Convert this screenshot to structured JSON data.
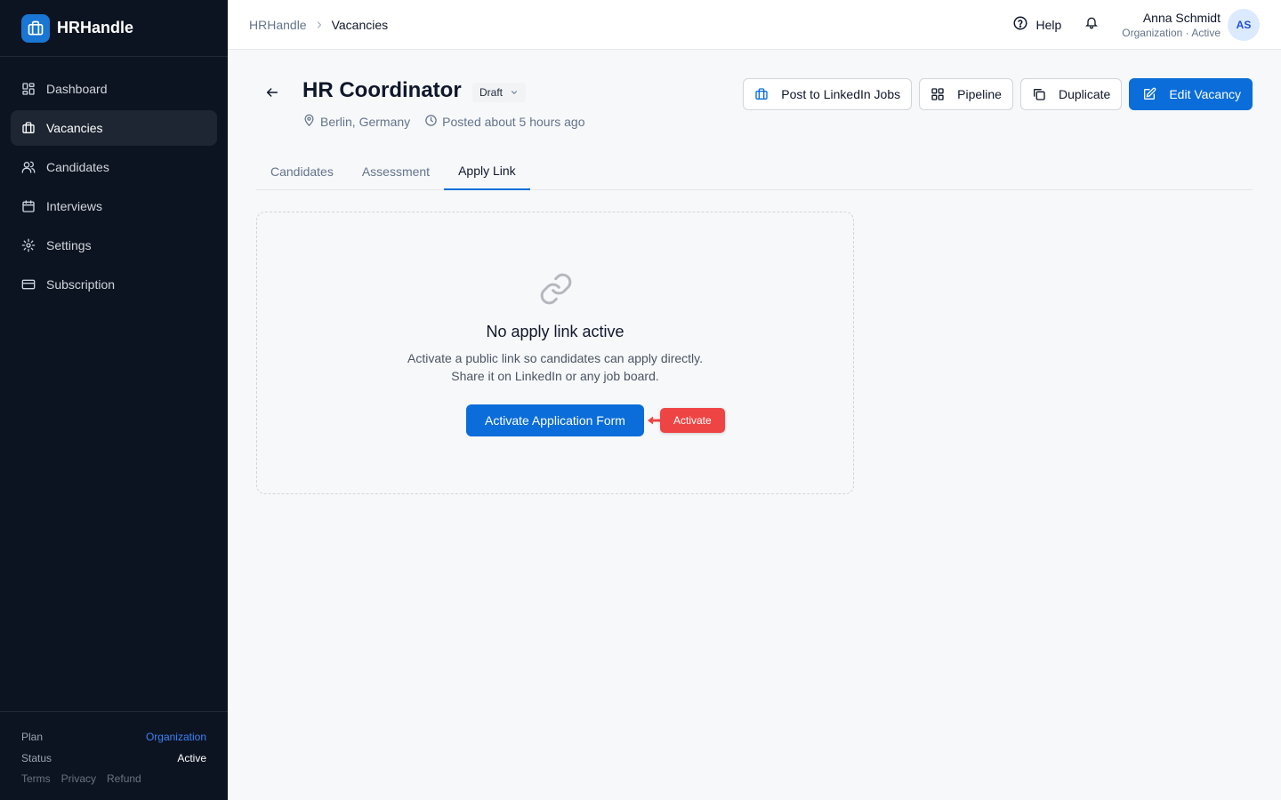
{
  "brand": {
    "name": "HRHandle",
    "icon": "briefcase-icon"
  },
  "sidebar": {
    "items": [
      {
        "label": "Dashboard",
        "icon": "dashboard-icon"
      },
      {
        "label": "Vacancies",
        "icon": "briefcase-icon",
        "active": true
      },
      {
        "label": "Candidates",
        "icon": "users-icon"
      },
      {
        "label": "Interviews",
        "icon": "calendar-icon"
      },
      {
        "label": "Settings",
        "icon": "gear-icon"
      },
      {
        "label": "Subscription",
        "icon": "credit-card-icon"
      }
    ],
    "footer": {
      "plan_label": "Plan",
      "plan_value": "Organization",
      "status_label": "Status",
      "status_value": "Active",
      "links": [
        "Terms",
        "Privacy",
        "Refund"
      ]
    }
  },
  "topbar": {
    "breadcrumb": {
      "root": "HRHandle",
      "current": "Vacancies"
    },
    "help_label": "Help",
    "user": {
      "name": "Anna Schmidt",
      "subtitle": "Organization · Active",
      "initials": "AS"
    }
  },
  "vacancy": {
    "title": "HR Coordinator",
    "status": "Draft",
    "location": "Berlin, Germany",
    "posted": "Posted about 5 hours ago"
  },
  "actions": {
    "linkedin": "Post to LinkedIn Jobs",
    "pipeline": "Pipeline",
    "duplicate": "Duplicate",
    "edit": "Edit Vacancy"
  },
  "tabs": [
    {
      "label": "Candidates"
    },
    {
      "label": "Assessment"
    },
    {
      "label": "Apply Link",
      "active": true
    }
  ],
  "apply_link": {
    "title": "No apply link active",
    "desc_line1": "Activate a public link so candidates can apply directly.",
    "desc_line2": "Share it on LinkedIn or any job board.",
    "button": "Activate Application Form",
    "pointer_badge": "Activate"
  },
  "colors": {
    "accent": "#0a6dd9",
    "sidebar_bg": "#0d1421",
    "badge": "#ef4444"
  }
}
